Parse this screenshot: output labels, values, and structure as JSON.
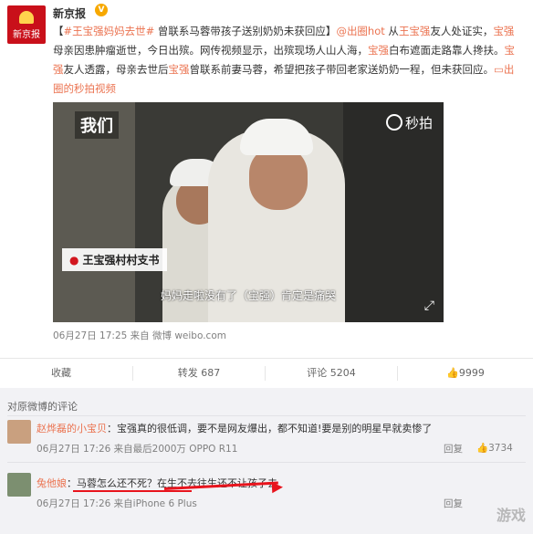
{
  "post": {
    "author": "新京报",
    "verified_mark": "V",
    "avatar_text": "新京报",
    "text_parts": {
      "p1": "【",
      "hashtag1": "#王宝强",
      "hashtag2": "妈妈去世#",
      "p2": " 曾联系马蓉带孩子送别奶奶未获回应】",
      "mention": "@出圈hot",
      "p3": " 从",
      "name1": "王宝强",
      "p4": "友人处证实，",
      "name2": "宝强",
      "p5": "母亲因患肿瘤逝世，今日出殡。网传视频显示，出殡现场人山人海，",
      "name3": "宝强",
      "p6": "白布遮面走路靠人搀扶。",
      "name4": "宝强",
      "p7": "友人透露，母亲去世后",
      "name5": "宝强",
      "p8": "曾联系前妻马蓉，希望把孩子带回老家送奶奶一程，但未获回应。",
      "video_link": "出圈的秒拍视频"
    },
    "media": {
      "brand": "我们",
      "provider": "秒拍",
      "name_caption": "王宝强村村支书",
      "subtitle": "妈妈走啦没有了（宝强）肯定是痛哭"
    },
    "time": "06月27日 17:25",
    "source": "来自 微博 weibo.com"
  },
  "actions": {
    "favorite": "收藏",
    "repost": "转发 687",
    "comment": "评论 5204",
    "like": "9999"
  },
  "comments": {
    "header": "对原微博的评论",
    "items": [
      {
        "user": "赵烨磊的小宝贝",
        "text": "：宝强真的很低调，要不是网友爆出，都不知道!要是别的明星早就卖惨了",
        "time": "06月27日 17:26",
        "source": "来自最后2000万 OPPO R11",
        "reply": "回复",
        "likes": "3734"
      },
      {
        "user": "兔他娘",
        "text": "：马蓉怎么还不死？在生不去往生还不让孩子去",
        "time": "06月27日 17:26",
        "source": "来自iPhone 6 Plus",
        "reply": "回复"
      }
    ]
  },
  "watermark": "游戏",
  "colors": {
    "accent": "#eb7350",
    "brand_red": "#c9101a",
    "annotation_red": "#e8141d"
  }
}
